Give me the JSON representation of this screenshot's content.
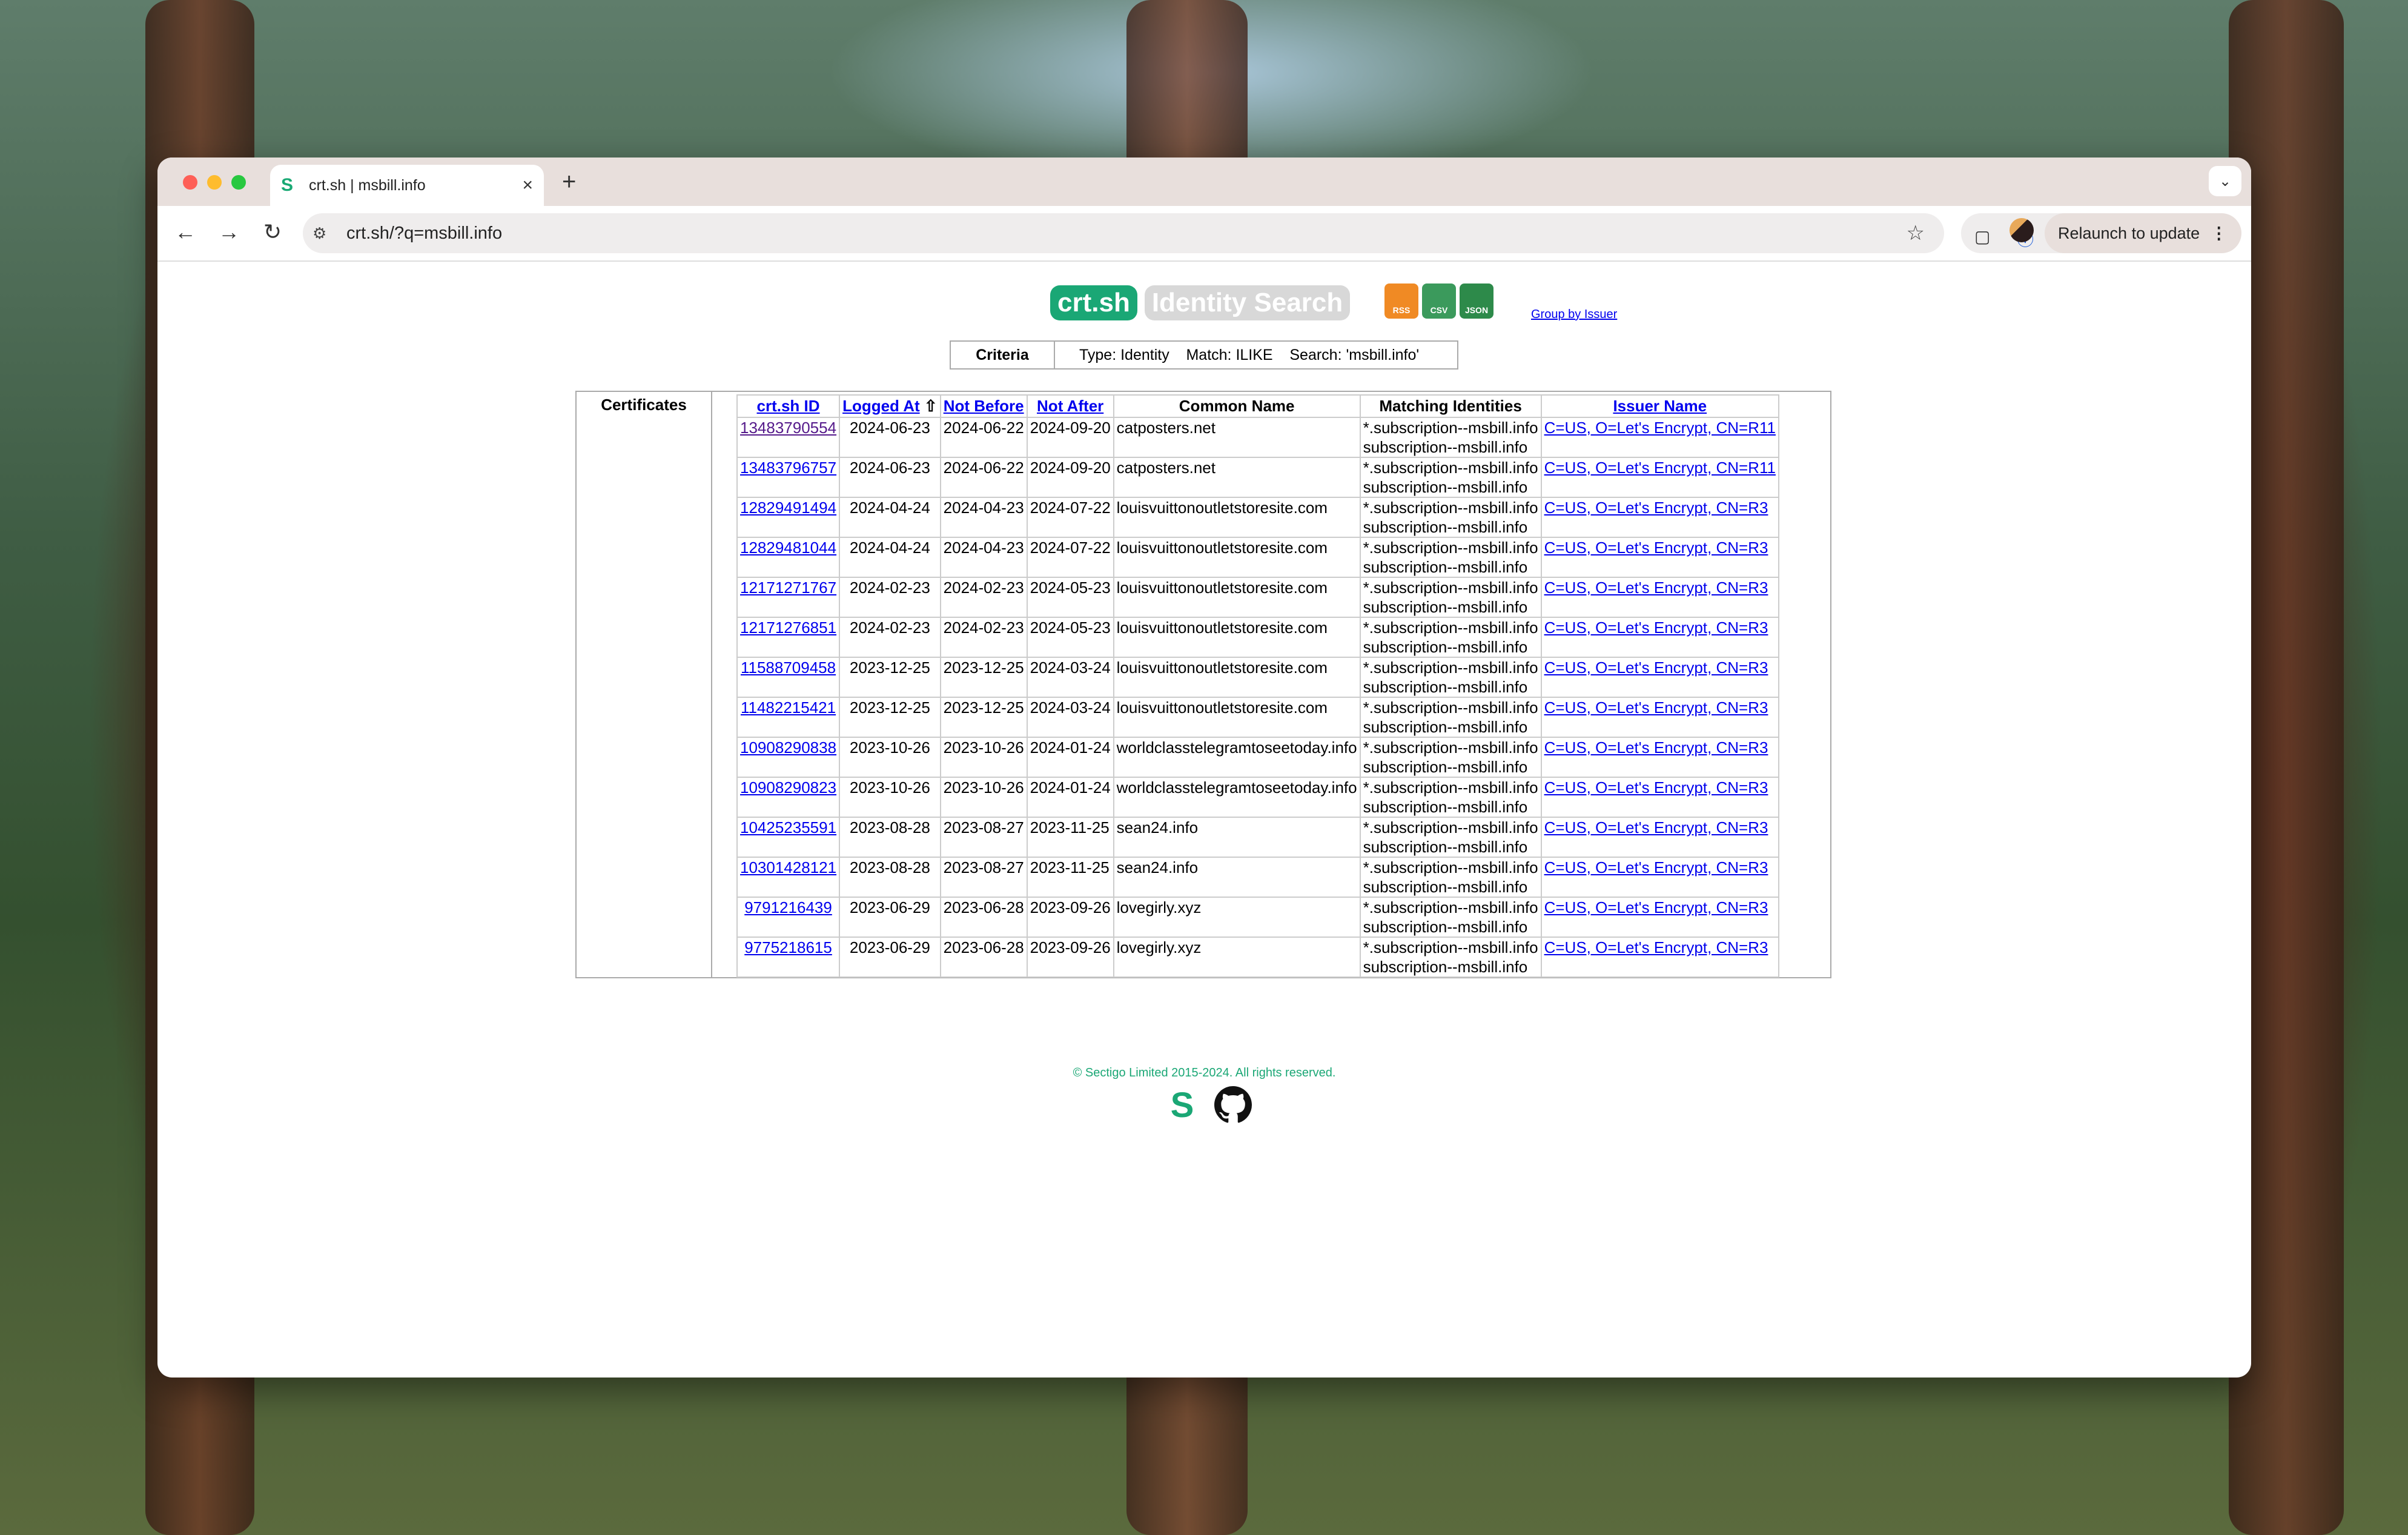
{
  "browser": {
    "tab_title": "crt.sh | msbill.info",
    "url": "crt.sh/?q=msbill.info",
    "relaunch_label": "Relaunch to update",
    "new_tab": "+",
    "tab_close": "×"
  },
  "header": {
    "logo_main": "crt.sh",
    "logo_sub": "Identity Search",
    "feed_rss": "RSS",
    "feed_csv": "CSV",
    "feed_json": "JSON",
    "group_link": "Group by Issuer"
  },
  "criteria": {
    "label": "Criteria",
    "value": "Type: Identity    Match: ILIKE    Search: 'msbill.info'"
  },
  "certificates_label": "Certificates",
  "table": {
    "headers": [
      "crt.sh ID",
      "Logged At",
      "Not Before",
      "Not After",
      "Common Name",
      "Matching Identities",
      "Issuer Name"
    ],
    "sort_icon": "⇧",
    "rows": [
      {
        "id": "13483790554",
        "logged": "2024-06-23",
        "nb": "2024-06-22",
        "na": "2024-09-20",
        "cn": "catposters.net",
        "m1": "*.subscription--msbill.info",
        "m2": "subscription--msbill.info",
        "issuer": "C=US, O=Let's Encrypt, CN=R11"
      },
      {
        "id": "13483796757",
        "logged": "2024-06-23",
        "nb": "2024-06-22",
        "na": "2024-09-20",
        "cn": "catposters.net",
        "m1": "*.subscription--msbill.info",
        "m2": "subscription--msbill.info",
        "issuer": "C=US, O=Let's Encrypt, CN=R11"
      },
      {
        "id": "12829491494",
        "logged": "2024-04-24",
        "nb": "2024-04-23",
        "na": "2024-07-22",
        "cn": "louisvuittonoutletstoresite.com",
        "m1": "*.subscription--msbill.info",
        "m2": "subscription--msbill.info",
        "issuer": "C=US, O=Let's Encrypt, CN=R3"
      },
      {
        "id": "12829481044",
        "logged": "2024-04-24",
        "nb": "2024-04-23",
        "na": "2024-07-22",
        "cn": "louisvuittonoutletstoresite.com",
        "m1": "*.subscription--msbill.info",
        "m2": "subscription--msbill.info",
        "issuer": "C=US, O=Let's Encrypt, CN=R3"
      },
      {
        "id": "12171271767",
        "logged": "2024-02-23",
        "nb": "2024-02-23",
        "na": "2024-05-23",
        "cn": "louisvuittonoutletstoresite.com",
        "m1": "*.subscription--msbill.info",
        "m2": "subscription--msbill.info",
        "issuer": "C=US, O=Let's Encrypt, CN=R3"
      },
      {
        "id": "12171276851",
        "logged": "2024-02-23",
        "nb": "2024-02-23",
        "na": "2024-05-23",
        "cn": "louisvuittonoutletstoresite.com",
        "m1": "*.subscription--msbill.info",
        "m2": "subscription--msbill.info",
        "issuer": "C=US, O=Let's Encrypt, CN=R3"
      },
      {
        "id": "11588709458",
        "logged": "2023-12-25",
        "nb": "2023-12-25",
        "na": "2024-03-24",
        "cn": "louisvuittonoutletstoresite.com",
        "m1": "*.subscription--msbill.info",
        "m2": "subscription--msbill.info",
        "issuer": "C=US, O=Let's Encrypt, CN=R3"
      },
      {
        "id": "11482215421",
        "logged": "2023-12-25",
        "nb": "2023-12-25",
        "na": "2024-03-24",
        "cn": "louisvuittonoutletstoresite.com",
        "m1": "*.subscription--msbill.info",
        "m2": "subscription--msbill.info",
        "issuer": "C=US, O=Let's Encrypt, CN=R3"
      },
      {
        "id": "10908290838",
        "logged": "2023-10-26",
        "nb": "2023-10-26",
        "na": "2024-01-24",
        "cn": "worldclasstelegramtoseetoday.info",
        "m1": "*.subscription--msbill.info",
        "m2": "subscription--msbill.info",
        "issuer": "C=US, O=Let's Encrypt, CN=R3"
      },
      {
        "id": "10908290823",
        "logged": "2023-10-26",
        "nb": "2023-10-26",
        "na": "2024-01-24",
        "cn": "worldclasstelegramtoseetoday.info",
        "m1": "*.subscription--msbill.info",
        "m2": "subscription--msbill.info",
        "issuer": "C=US, O=Let's Encrypt, CN=R3"
      },
      {
        "id": "10425235591",
        "logged": "2023-08-28",
        "nb": "2023-08-27",
        "na": "2023-11-25",
        "cn": "sean24.info",
        "m1": "*.subscription--msbill.info",
        "m2": "subscription--msbill.info",
        "issuer": "C=US, O=Let's Encrypt, CN=R3"
      },
      {
        "id": "10301428121",
        "logged": "2023-08-28",
        "nb": "2023-08-27",
        "na": "2023-11-25",
        "cn": "sean24.info",
        "m1": "*.subscription--msbill.info",
        "m2": "subscription--msbill.info",
        "issuer": "C=US, O=Let's Encrypt, CN=R3"
      },
      {
        "id": "9791216439",
        "logged": "2023-06-29",
        "nb": "2023-06-28",
        "na": "2023-09-26",
        "cn": "lovegirly.xyz",
        "m1": "*.subscription--msbill.info",
        "m2": "subscription--msbill.info",
        "issuer": "C=US, O=Let's Encrypt, CN=R3"
      },
      {
        "id": "9775218615",
        "logged": "2023-06-29",
        "nb": "2023-06-28",
        "na": "2023-09-26",
        "cn": "lovegirly.xyz",
        "m1": "*.subscription--msbill.info",
        "m2": "subscription--msbill.info",
        "issuer": "C=US, O=Let's Encrypt, CN=R3"
      }
    ]
  },
  "footer": {
    "copyright": "© Sectigo Limited 2015-2024. All rights reserved."
  },
  "colors": {
    "brand": "#1aa775",
    "link": "#0000ee",
    "visited_link": "#551a8b"
  }
}
